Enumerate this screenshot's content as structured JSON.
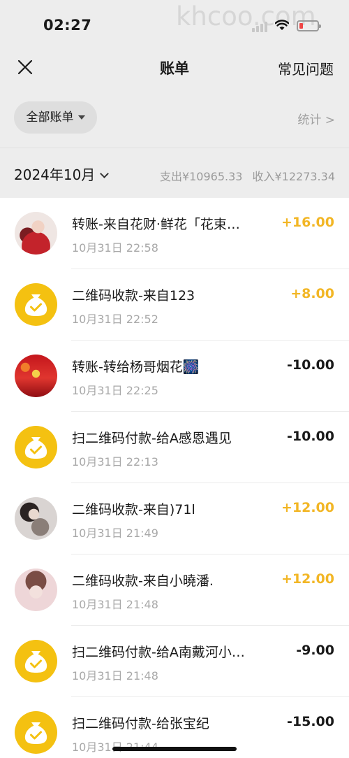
{
  "status_bar": {
    "time": "02:27",
    "watermark": "khcoo.com",
    "battery_color": "#f04545"
  },
  "nav": {
    "title": "账单",
    "faq_label": "常见问题"
  },
  "filter": {
    "chip_label": "全部账单",
    "stats_label": "统计 >"
  },
  "month": {
    "label": "2024年10月",
    "expense_summary": "支出¥10965.33",
    "income_summary": "收入¥12273.34"
  },
  "colors": {
    "income": "#f2b625",
    "coin": "#f4c111",
    "background": "#ededed"
  },
  "transactions": [
    {
      "title": "转账-来自花财·鲜花「花束…",
      "time": "10月31日 22:58",
      "amount": "+16.00",
      "type": "income",
      "avatar": "photo-a1"
    },
    {
      "title": "二维码收款-来自123",
      "time": "10月31日 22:52",
      "amount": "+8.00",
      "type": "income",
      "avatar": "coin"
    },
    {
      "title": "转账-转给杨哥烟花🎆",
      "time": "10月31日 22:25",
      "amount": "-10.00",
      "type": "expense",
      "avatar": "photo-a2"
    },
    {
      "title": "扫二维码付款-给A感恩遇见",
      "time": "10月31日 22:13",
      "amount": "-10.00",
      "type": "expense",
      "avatar": "coin"
    },
    {
      "title": "二维码收款-来自)71l",
      "time": "10月31日 21:49",
      "amount": "+12.00",
      "type": "income",
      "avatar": "photo-a3"
    },
    {
      "title": "二维码收款-来自小曉潘.",
      "time": "10月31日 21:48",
      "amount": "+12.00",
      "type": "income",
      "avatar": "photo-a4"
    },
    {
      "title": "扫二维码付款-给A南戴河小…",
      "time": "10月31日 21:48",
      "amount": "-9.00",
      "type": "expense",
      "avatar": "coin"
    },
    {
      "title": "扫二维码付款-给张宝纪",
      "time": "10月31日 21:44",
      "amount": "-15.00",
      "type": "expense",
      "avatar": "coin"
    }
  ]
}
